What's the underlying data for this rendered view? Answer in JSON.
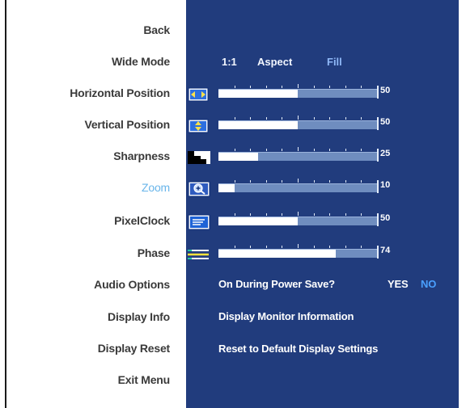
{
  "menu": {
    "items": [
      {
        "label": "Back"
      },
      {
        "label": "Wide Mode"
      },
      {
        "label": "Horizontal Position"
      },
      {
        "label": "Vertical Position"
      },
      {
        "label": "Sharpness"
      },
      {
        "label": "Zoom"
      },
      {
        "label": "PixelClock"
      },
      {
        "label": "Phase"
      },
      {
        "label": "Audio Options"
      },
      {
        "label": "Display Info"
      },
      {
        "label": "Display Reset"
      },
      {
        "label": "Exit Menu"
      }
    ],
    "active": "Zoom"
  },
  "wide_mode": {
    "options": [
      "1:1",
      "Aspect",
      "Fill"
    ],
    "selected": "Fill"
  },
  "sliders": [
    {
      "id": "horizontal-position",
      "icon": "horizontal-position-icon",
      "value": 50,
      "value_text": "50"
    },
    {
      "id": "vertical-position",
      "icon": "vertical-position-icon",
      "value": 50,
      "value_text": "50"
    },
    {
      "id": "sharpness",
      "icon": "sharpness-icon",
      "value": 25,
      "value_text": "25"
    },
    {
      "id": "zoom",
      "icon": "zoom-icon",
      "value": 10,
      "value_text": "10"
    },
    {
      "id": "pixel-clock",
      "icon": "pixel-clock-icon",
      "value": 50,
      "value_text": "50"
    },
    {
      "id": "phase",
      "icon": "phase-icon",
      "value": 74,
      "value_text": "74"
    }
  ],
  "audio": {
    "label": "On During Power Save?",
    "yes": "YES",
    "no": "NO",
    "selected": "NO"
  },
  "display_info": {
    "label": "Display Monitor Information"
  },
  "display_reset": {
    "label": "Reset to Default Display Settings"
  },
  "colors": {
    "panel_bg": "#213c7d",
    "active_item": "#69b5ea",
    "selected_option": "#8fb8f7"
  }
}
